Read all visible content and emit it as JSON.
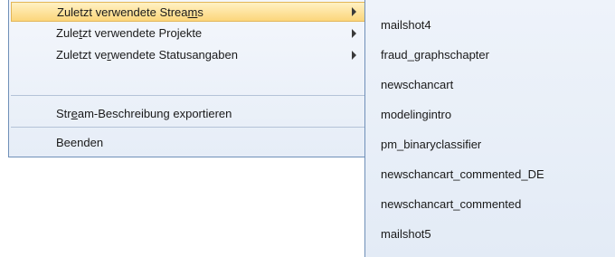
{
  "menu": {
    "items": [
      {
        "pre": "Zuletzt verwendete Strea",
        "accel": "m",
        "post": "s"
      },
      {
        "pre": "Zule",
        "accel": "t",
        "post": "zt verwendete Projekte"
      },
      {
        "pre": "Zuletzt ve",
        "accel": "r",
        "post": "wendete Statusangaben"
      },
      {
        "pre": "Str",
        "accel": "e",
        "post": "am-Beschreibung exportieren"
      },
      {
        "pre": "Beenden",
        "accel": "",
        "post": ""
      }
    ]
  },
  "submenu": {
    "items": [
      "mailshot4",
      "fraud_graphschapter",
      "newschancart",
      "modelingintro",
      "pm_binaryclassifier",
      "newschancart_commented_DE",
      "newschancart_commented",
      "mailshot5"
    ]
  },
  "colors": {
    "highlight": "#fcd67b",
    "menu_bg": "#e6edf7",
    "border": "#6f8fb8"
  }
}
